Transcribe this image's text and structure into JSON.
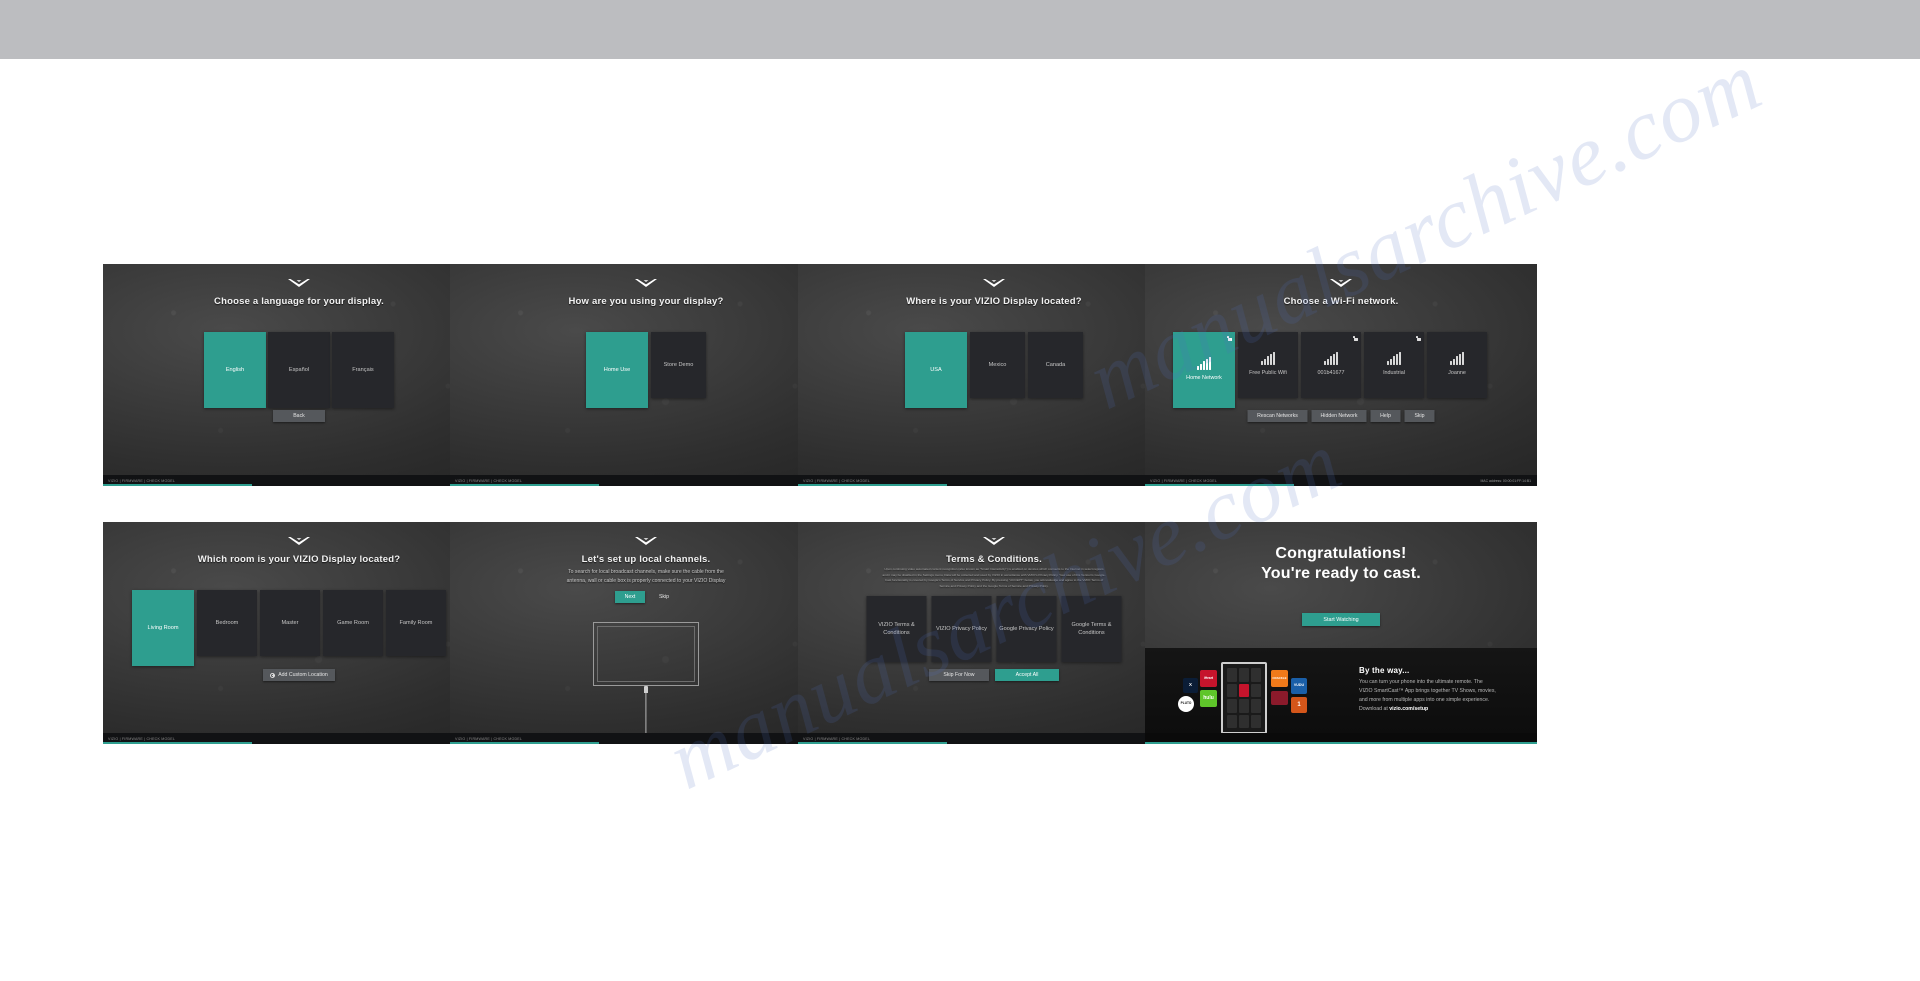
{
  "document": {
    "type": "manual-page-screenshot",
    "top_bar_color": "#bcbdc0",
    "watermark_text": "manualsarchive.com"
  },
  "theme": {
    "accent": "#2e9e8f",
    "tile_bg": "#26272b",
    "button_bg": "#55585c",
    "text_primary": "#ffffff",
    "text_secondary": "#c6c6c6"
  },
  "panels": [
    {
      "id": "language",
      "headline": "Choose a language for your display.",
      "tiles": [
        {
          "label": "English",
          "selected": true
        },
        {
          "label": "Español",
          "selected": false
        },
        {
          "label": "Français",
          "selected": false
        }
      ],
      "buttons": [
        {
          "label": "Back",
          "primary": false
        }
      ],
      "status": {
        "crumbs": "VIZIO  |  FIRMWARE  |  CHECK MODEL",
        "mac": "",
        "progress_pct": 38
      }
    },
    {
      "id": "usage",
      "headline": "How are you using your display?",
      "tiles": [
        {
          "label": "Home Use",
          "selected": true
        },
        {
          "label": "Store Demo",
          "selected": false
        }
      ],
      "buttons": [],
      "status": {
        "crumbs": "VIZIO  |  FIRMWARE  |  CHECK MODEL",
        "mac": "",
        "progress_pct": 38
      }
    },
    {
      "id": "country",
      "headline": "Where is your VIZIO Display located?",
      "tiles": [
        {
          "label": "USA",
          "selected": true
        },
        {
          "label": "Mexico",
          "selected": false
        },
        {
          "label": "Canada",
          "selected": false
        }
      ],
      "buttons": [],
      "status": {
        "crumbs": "VIZIO  |  FIRMWARE  |  CHECK MODEL",
        "mac": "",
        "progress_pct": 38
      }
    },
    {
      "id": "wifi",
      "headline": "Choose a Wi-Fi network.",
      "networks": [
        {
          "label": "Home Network",
          "selected": true,
          "locked": true
        },
        {
          "label": "Free Public Wifi",
          "selected": false,
          "locked": false
        },
        {
          "label": "001b41677",
          "selected": false,
          "locked": true
        },
        {
          "label": "Industrial",
          "selected": false,
          "locked": true
        },
        {
          "label": "Joanne",
          "selected": false,
          "locked": false
        }
      ],
      "buttons": [
        {
          "label": "Rescan Networks",
          "primary": false
        },
        {
          "label": "Hidden Network",
          "primary": false
        },
        {
          "label": "Help",
          "primary": false
        },
        {
          "label": "Skip",
          "primary": false
        }
      ],
      "status": {
        "crumbs": "VIZIO  |  FIRMWARE  |  CHECK MODEL",
        "mac": "MAC address: 00:00:01:FF:14:B1",
        "progress_pct": 38
      }
    },
    {
      "id": "room",
      "headline": "Which room is your VIZIO Display located?",
      "tiles": [
        {
          "label": "Living Room",
          "selected": true
        },
        {
          "label": "Bedroom",
          "selected": false
        },
        {
          "label": "Master",
          "selected": false
        },
        {
          "label": "Game Room",
          "selected": false
        },
        {
          "label": "Family Room",
          "selected": false
        }
      ],
      "buttons": [
        {
          "label": "Add Custom Location",
          "primary": false,
          "icon": "plus-circle-icon"
        }
      ],
      "status": {
        "crumbs": "VIZIO  |  FIRMWARE  |  CHECK MODEL",
        "mac": "",
        "progress_pct": 38
      }
    },
    {
      "id": "channels",
      "headline": "Let's set up local channels.",
      "subtext_line1": "To search for local broadcast channels, make sure the cable from the",
      "subtext_line2": "antenna, wall or cable box is properly connected to your VIZIO Display",
      "buttons": [
        {
          "label": "Next",
          "primary": true
        },
        {
          "label": "Skip",
          "primary": false
        }
      ],
      "status": {
        "crumbs": "VIZIO  |  FIRMWARE  |  CHECK MODEL",
        "mac": "",
        "progress_pct": 38
      }
    },
    {
      "id": "terms",
      "headline": "Terms & Conditions.",
      "legal_lines": [
        "Upon continuing video automated content recognition (also known as \"Smart Interactivity\") is enabled on devices which connects to the Internet in select regions",
        "and it may be disabled in the Settings menu. Data will be collected and used by VIZIO in accordance with VIZIO's Privacy Policy. Your use of this Version's Google-",
        "Cast functionality is covered by Google's Terms of Service and Privacy Policy. By pressing \"ACCEPT\" below, you acknowledge and agree to the VIZIO Terms of",
        "Service and Privacy Policy and the Google Terms of Service and Privacy Policy."
      ],
      "tiles": [
        {
          "label": "VIZIO Terms & Conditions",
          "selected": false
        },
        {
          "label": "VIZIO Privacy Policy",
          "selected": false
        },
        {
          "label": "Google Privacy Policy",
          "selected": false
        },
        {
          "label": "Google Terms & Conditions",
          "selected": false
        }
      ],
      "buttons": [
        {
          "label": "Skip For Now",
          "primary": false
        },
        {
          "label": "Accept All",
          "primary": true
        }
      ],
      "status": {
        "crumbs": "VIZIO  |  FIRMWARE  |  CHECK MODEL",
        "mac": "",
        "progress_pct": 38
      }
    },
    {
      "id": "done",
      "headline_line1": "Congratulations!",
      "headline_line2": "You're ready to cast.",
      "buttons": [
        {
          "label": "Start Watching",
          "primary": true
        }
      ],
      "promo": {
        "title": "By the way...",
        "lines": [
          "You can turn your phone into the ultimate remote. The",
          "VIZIO SmartCast™ App brings together TV Shows, movies,",
          "and more from multiple apps into one simple experience."
        ],
        "download_prefix": "Download at ",
        "download_link": "vizio.com/setup"
      },
      "app_icons": [
        {
          "name": "xfinity-app-icon",
          "label": "X",
          "bg": "#0b1d36",
          "fg": "#ffffff"
        },
        {
          "name": "pluto-tv-app-icon",
          "label": "PLUTO",
          "bg": "#ffffff",
          "fg": "#111111"
        },
        {
          "name": "iheart-app-icon",
          "label": "iHeart",
          "bg": "#c6142c",
          "fg": "#ffffff"
        },
        {
          "name": "hulu-app-icon",
          "label": "hulu",
          "bg": "#5ec52a",
          "fg": "#ffffff"
        },
        {
          "name": "crackle-app-icon",
          "label": "CRACKLE",
          "bg": "#f07a1a",
          "fg": "#ffffff"
        },
        {
          "name": "vudu-app-icon",
          "label": "VUDU",
          "bg": "#1a5fa8",
          "fg": "#ffffff"
        },
        {
          "name": "redbull-app-icon",
          "label": "",
          "bg": "#8b1a2b",
          "fg": "#ffffff"
        },
        {
          "name": "nbc-one-app-icon",
          "label": "1",
          "bg": "#d4561a",
          "fg": "#ffffff"
        }
      ],
      "status": {
        "crumbs": "",
        "mac": "",
        "progress_pct": 100
      }
    }
  ]
}
